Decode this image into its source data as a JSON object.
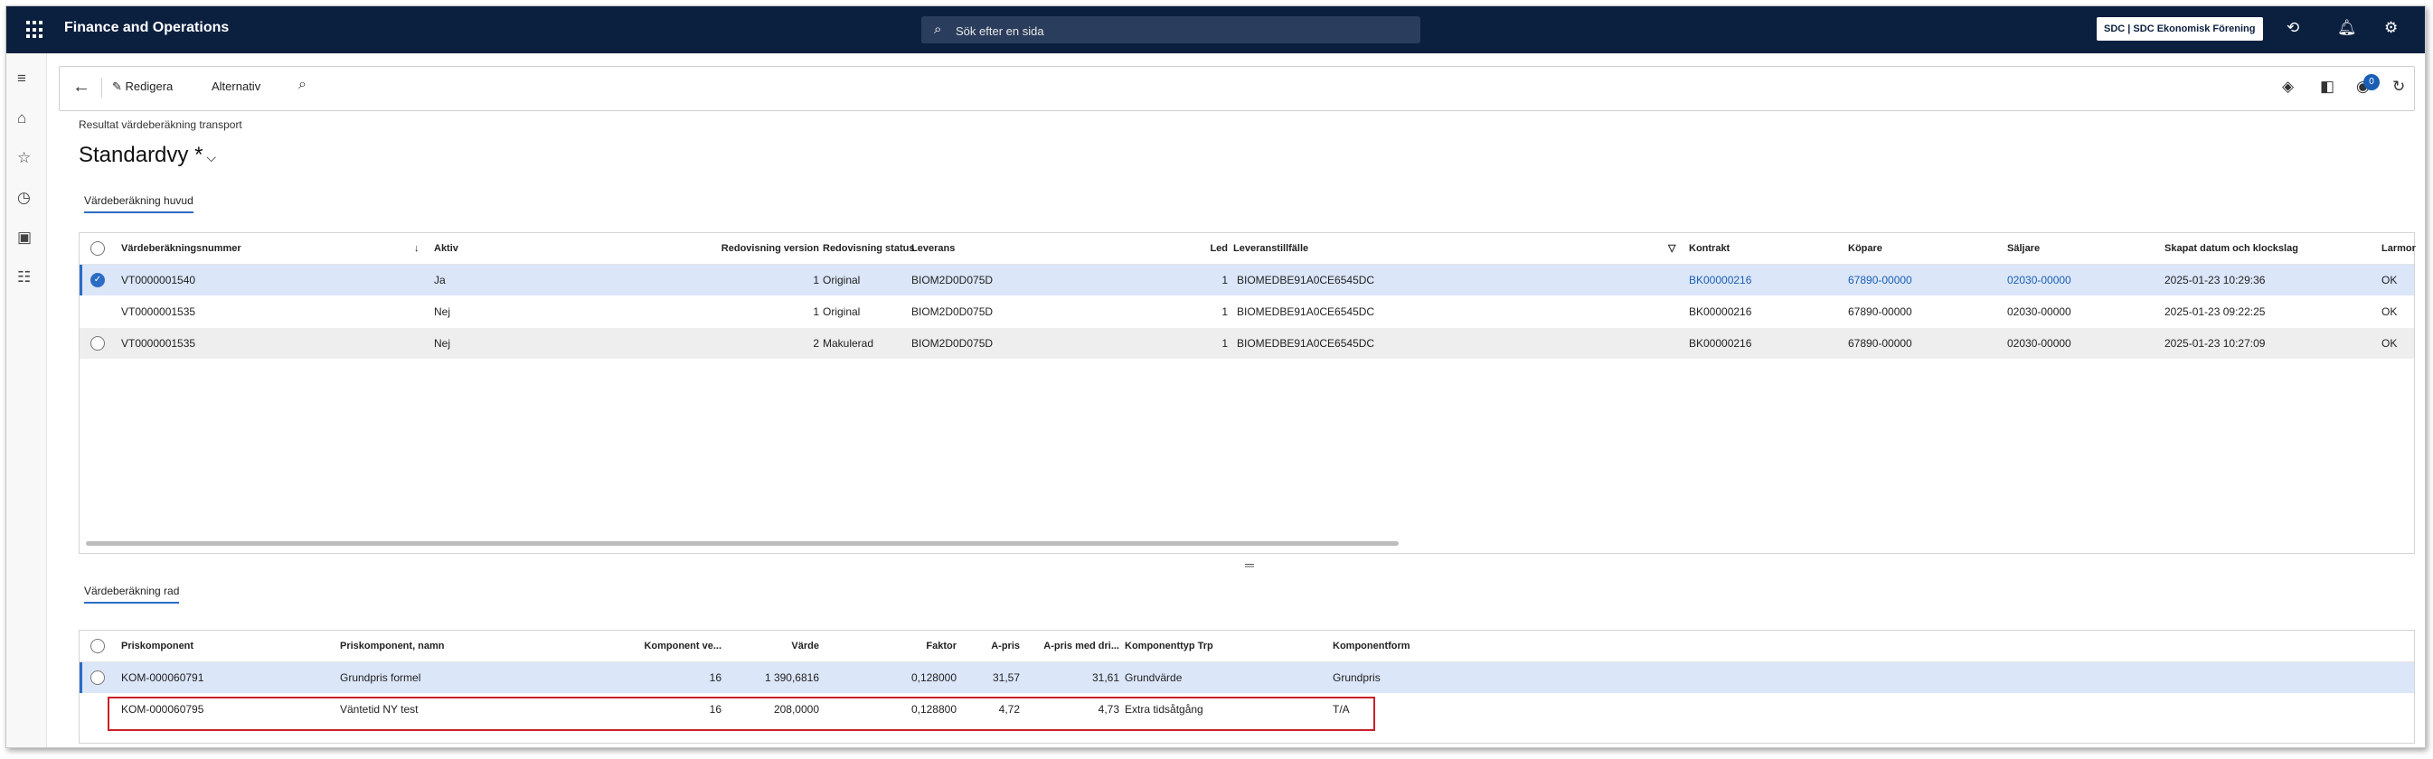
{
  "app": {
    "title": "Finance and Operations",
    "company": "SDC | SDC Ekonomisk Förening"
  },
  "search": {
    "placeholder": "Sök efter en sida"
  },
  "toolbar": {
    "edit_label": "Redigera",
    "options_label": "Alternativ"
  },
  "page": {
    "breadcrumb": "Resultat värdeberäkning transport",
    "title": "Standardvy *"
  },
  "header_grid": {
    "tab": "Värdeberäkning huvud",
    "columns": [
      "Värdeberäkningsnummer",
      "Aktiv",
      "Redovisning version",
      "Redovisning status",
      "Leverans",
      "Led",
      "Leveranstillfälle",
      "Kontrakt",
      "Köpare",
      "Säljare",
      "Skapat datum och klockslag",
      "Larmor"
    ],
    "rows": [
      {
        "number": "VT0000001540",
        "active": "Ja",
        "version": "1",
        "status": "Original",
        "delivery": "BIOM2D0D075D",
        "led": "1",
        "occasion": "BIOMEDBE91A0CE6545DC",
        "contract": "BK00000216",
        "buyer": "67890-00000",
        "seller": "02030-00000",
        "created": "2025-01-23 10:29:36",
        "alarm": "OK",
        "selected": true
      },
      {
        "number": "VT0000001535",
        "active": "Nej",
        "version": "1",
        "status": "Original",
        "delivery": "BIOM2D0D075D",
        "led": "1",
        "occasion": "BIOMEDBE91A0CE6545DC",
        "contract": "BK00000216",
        "buyer": "67890-00000",
        "seller": "02030-00000",
        "created": "2025-01-23 09:22:25",
        "alarm": "OK",
        "selected": false
      },
      {
        "number": "VT0000001535",
        "active": "Nej",
        "version": "2",
        "status": "Makulerad",
        "delivery": "BIOM2D0D075D",
        "led": "1",
        "occasion": "BIOMEDBE91A0CE6545DC",
        "contract": "BK00000216",
        "buyer": "67890-00000",
        "seller": "02030-00000",
        "created": "2025-01-23 10:27:09",
        "alarm": "OK",
        "selected": false
      }
    ]
  },
  "row_grid": {
    "tab": "Värdeberäkning rad",
    "columns": [
      "Priskomponent",
      "Priskomponent, namn",
      "Komponent ve...",
      "Värde",
      "Faktor",
      "A-pris",
      "A-pris med dri...",
      "Komponenttyp Trp",
      "Komponentform"
    ],
    "rows": [
      {
        "component": "KOM-000060791",
        "name": "Grundpris formel",
        "version": "16",
        "value": "1 390,6816",
        "factor": "0,128000",
        "unit_price": "31,57",
        "unit_price_ops": "31,61",
        "type": "Grundvärde",
        "form": "Grundpris",
        "selected": true
      },
      {
        "component": "KOM-000060795",
        "name": "Väntetid NY test",
        "version": "16",
        "value": "208,0000",
        "factor": "0,128800",
        "unit_price": "4,72",
        "unit_price_ops": "4,73",
        "type": "Extra tidsåtgång",
        "form": "T/A",
        "selected": false
      }
    ]
  }
}
